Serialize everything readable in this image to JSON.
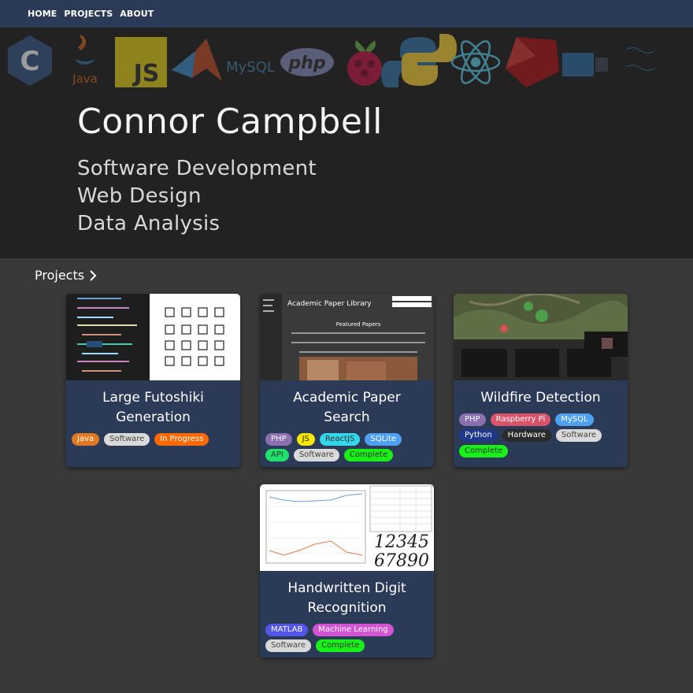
{
  "nav": {
    "home": "HOME",
    "projects": "PROJECTS",
    "about": "ABOUT"
  },
  "hero": {
    "logo_icons": [
      "c-icon",
      "java-icon",
      "javascript-icon",
      "matlab-icon",
      "mysql-icon",
      "php-icon",
      "raspberry-pi-icon",
      "python-icon",
      "react-icon",
      "ruby-icon",
      "docker-icon",
      "tailwind-icon"
    ],
    "logo_labels": {
      "java": "Java",
      "js": "JS",
      "mysql": "MySQL",
      "php": "php"
    },
    "name": "Connor Campbell",
    "lines": [
      "Software Development",
      "Web Design",
      "Data Analysis"
    ]
  },
  "projects": {
    "heading": "Projects",
    "cards": [
      {
        "title": "Large Futoshiki Generation",
        "tags": [
          {
            "label": "Java",
            "bg": "#e07a22",
            "fg": "#ffffff"
          },
          {
            "label": "Software",
            "bg": "#d9d9d9",
            "fg": "#444444"
          },
          {
            "label": "In Progress",
            "bg": "#ff6a00",
            "fg": "#ffffff"
          }
        ]
      },
      {
        "title": "Academic Paper Search",
        "thumb_text": {
          "site": "Academic Paper Library",
          "featured": "Featured Papers"
        },
        "tags": [
          {
            "label": "PHP",
            "bg": "#8a6fb1",
            "fg": "#ffffff"
          },
          {
            "label": "JS",
            "bg": "#f6e800",
            "fg": "#333333"
          },
          {
            "label": "ReactJS",
            "bg": "#33d6ea",
            "fg": "#333333"
          },
          {
            "label": "SQLite",
            "bg": "#4ea0f0",
            "fg": "#ffffff"
          },
          {
            "label": "API",
            "bg": "#1fe26a",
            "fg": "#333333"
          },
          {
            "label": "Software",
            "bg": "#d9d9d9",
            "fg": "#444444"
          },
          {
            "label": "Complete",
            "bg": "#18f018",
            "fg": "#333333"
          }
        ]
      },
      {
        "title": "Wildfire Detection",
        "tags": [
          {
            "label": "PHP",
            "bg": "#8a6fb1",
            "fg": "#ffffff"
          },
          {
            "label": "Raspberry Pi",
            "bg": "#d9546a",
            "fg": "#ffffff"
          },
          {
            "label": "MySQL",
            "bg": "#4ea0f0",
            "fg": "#ffffff"
          },
          {
            "label": "Python",
            "bg": "#1f3a8a",
            "fg": "#ffffff"
          },
          {
            "label": "Hardware",
            "bg": "#2a2a2a",
            "fg": "#ffffff"
          },
          {
            "label": "Software",
            "bg": "#d9d9d9",
            "fg": "#444444"
          },
          {
            "label": "Complete",
            "bg": "#18f018",
            "fg": "#333333"
          }
        ]
      },
      {
        "title": "Handwritten Digit Recognition",
        "thumb_text": {
          "digits_top": "12345",
          "digits_bottom": "67890"
        },
        "tags": [
          {
            "label": "MATLAB",
            "bg": "#5555e8",
            "fg": "#ffffff"
          },
          {
            "label": "Machine Learning",
            "bg": "#d154d1",
            "fg": "#ffffff"
          },
          {
            "label": "Software",
            "bg": "#d9d9d9",
            "fg": "#444444"
          },
          {
            "label": "Complete",
            "bg": "#18f018",
            "fg": "#333333"
          }
        ]
      }
    ]
  }
}
